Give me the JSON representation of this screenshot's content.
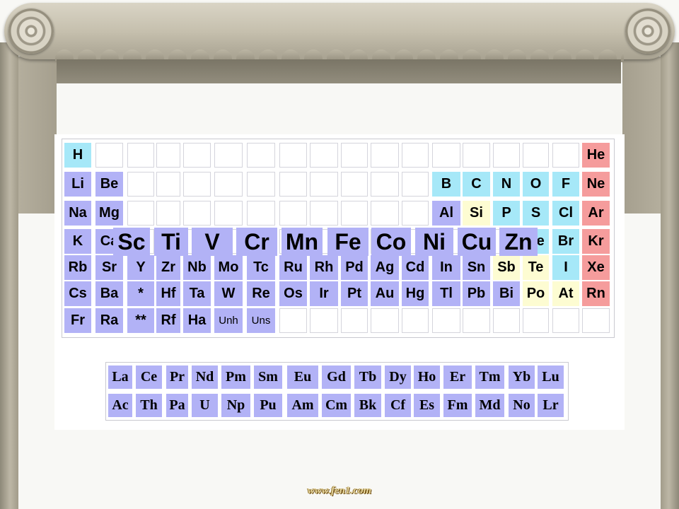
{
  "colors": {
    "cyan": "#a6e8f8",
    "lavender": "#b2b2f6",
    "yellow": "#fdfcd2",
    "pink": "#f59c9c",
    "stone": "#c6c0ae"
  },
  "periodic_table": {
    "rows": [
      [
        {
          "s": "H",
          "c": "cyan"
        },
        {
          "s": "",
          "c": "blank"
        },
        {
          "s": "",
          "c": "blank"
        },
        {
          "s": "",
          "c": "blank"
        },
        {
          "s": "",
          "c": "blank"
        },
        {
          "s": "",
          "c": "blank"
        },
        {
          "s": "",
          "c": "blank"
        },
        {
          "s": "",
          "c": "blank"
        },
        {
          "s": "",
          "c": "blank"
        },
        {
          "s": "",
          "c": "blank"
        },
        {
          "s": "",
          "c": "blank"
        },
        {
          "s": "",
          "c": "blank"
        },
        {
          "s": "",
          "c": "blank"
        },
        {
          "s": "",
          "c": "blank"
        },
        {
          "s": "",
          "c": "blank"
        },
        {
          "s": "",
          "c": "blank"
        },
        {
          "s": "",
          "c": "blank"
        },
        {
          "s": "He",
          "c": "pink"
        }
      ],
      [
        {
          "s": "Li",
          "c": "lavender"
        },
        {
          "s": "Be",
          "c": "lavender"
        },
        {
          "s": "",
          "c": "blank"
        },
        {
          "s": "",
          "c": "blank"
        },
        {
          "s": "",
          "c": "blank"
        },
        {
          "s": "",
          "c": "blank"
        },
        {
          "s": "",
          "c": "blank"
        },
        {
          "s": "",
          "c": "blank"
        },
        {
          "s": "",
          "c": "blank"
        },
        {
          "s": "",
          "c": "blank"
        },
        {
          "s": "",
          "c": "blank"
        },
        {
          "s": "",
          "c": "blank"
        },
        {
          "s": "B",
          "c": "cyan"
        },
        {
          "s": "C",
          "c": "cyan"
        },
        {
          "s": "N",
          "c": "cyan"
        },
        {
          "s": "O",
          "c": "cyan"
        },
        {
          "s": "F",
          "c": "cyan"
        },
        {
          "s": "Ne",
          "c": "pink"
        }
      ],
      [
        {
          "s": "Na",
          "c": "lavender"
        },
        {
          "s": "Mg",
          "c": "lavender"
        },
        {
          "s": "",
          "c": "blank"
        },
        {
          "s": "",
          "c": "blank"
        },
        {
          "s": "",
          "c": "blank"
        },
        {
          "s": "",
          "c": "blank"
        },
        {
          "s": "",
          "c": "blank"
        },
        {
          "s": "",
          "c": "blank"
        },
        {
          "s": "",
          "c": "blank"
        },
        {
          "s": "",
          "c": "blank"
        },
        {
          "s": "",
          "c": "blank"
        },
        {
          "s": "",
          "c": "blank"
        },
        {
          "s": "Al",
          "c": "lavender"
        },
        {
          "s": "Si",
          "c": "yellow"
        },
        {
          "s": "P",
          "c": "cyan"
        },
        {
          "s": "S",
          "c": "cyan"
        },
        {
          "s": "Cl",
          "c": "cyan"
        },
        {
          "s": "Ar",
          "c": "pink"
        }
      ],
      [
        {
          "s": "K",
          "c": "lavender"
        },
        {
          "s": "Ca",
          "c": "lavender"
        },
        {
          "s": "",
          "c": "blank"
        },
        {
          "s": "",
          "c": "blank"
        },
        {
          "s": "",
          "c": "blank"
        },
        {
          "s": "",
          "c": "blank"
        },
        {
          "s": "",
          "c": "blank"
        },
        {
          "s": "",
          "c": "blank"
        },
        {
          "s": "",
          "c": "blank"
        },
        {
          "s": "",
          "c": "blank"
        },
        {
          "s": "",
          "c": "blank"
        },
        {
          "s": "",
          "c": "blank"
        },
        {
          "s": "",
          "c": "blank"
        },
        {
          "s": "",
          "c": "blank"
        },
        {
          "s": "",
          "c": "blank"
        },
        {
          "s": "Se",
          "c": "cyan"
        },
        {
          "s": "Br",
          "c": "cyan"
        },
        {
          "s": "Kr",
          "c": "pink"
        }
      ],
      [
        {
          "s": "Rb",
          "c": "lavender"
        },
        {
          "s": "Sr",
          "c": "lavender"
        },
        {
          "s": "Y",
          "c": "lavender"
        },
        {
          "s": "Zr",
          "c": "lavender"
        },
        {
          "s": "Nb",
          "c": "lavender"
        },
        {
          "s": "Mo",
          "c": "lavender"
        },
        {
          "s": "Tc",
          "c": "lavender"
        },
        {
          "s": "Ru",
          "c": "lavender"
        },
        {
          "s": "Rh",
          "c": "lavender"
        },
        {
          "s": "Pd",
          "c": "lavender"
        },
        {
          "s": "Ag",
          "c": "lavender"
        },
        {
          "s": "Cd",
          "c": "lavender"
        },
        {
          "s": "In",
          "c": "lavender"
        },
        {
          "s": "Sn",
          "c": "lavender"
        },
        {
          "s": "Sb",
          "c": "yellow"
        },
        {
          "s": "Te",
          "c": "yellow"
        },
        {
          "s": "I",
          "c": "cyan"
        },
        {
          "s": "Xe",
          "c": "pink"
        }
      ],
      [
        {
          "s": "Cs",
          "c": "lavender"
        },
        {
          "s": "Ba",
          "c": "lavender"
        },
        {
          "s": "*",
          "c": "lavender"
        },
        {
          "s": "Hf",
          "c": "lavender"
        },
        {
          "s": "Ta",
          "c": "lavender"
        },
        {
          "s": "W",
          "c": "lavender"
        },
        {
          "s": "Re",
          "c": "lavender"
        },
        {
          "s": "Os",
          "c": "lavender"
        },
        {
          "s": "Ir",
          "c": "lavender"
        },
        {
          "s": "Pt",
          "c": "lavender"
        },
        {
          "s": "Au",
          "c": "lavender"
        },
        {
          "s": "Hg",
          "c": "lavender"
        },
        {
          "s": "Tl",
          "c": "lavender"
        },
        {
          "s": "Pb",
          "c": "lavender"
        },
        {
          "s": "Bi",
          "c": "lavender"
        },
        {
          "s": "Po",
          "c": "yellow"
        },
        {
          "s": "At",
          "c": "yellow"
        },
        {
          "s": "Rn",
          "c": "pink"
        }
      ],
      [
        {
          "s": "Fr",
          "c": "lavender"
        },
        {
          "s": "Ra",
          "c": "lavender"
        },
        {
          "s": "**",
          "c": "lavender"
        },
        {
          "s": "Rf",
          "c": "lavender"
        },
        {
          "s": "Ha",
          "c": "lavender"
        },
        {
          "s": "Unh",
          "c": "lavender"
        },
        {
          "s": "Uns",
          "c": "lavender"
        },
        {
          "s": "",
          "c": "blank"
        },
        {
          "s": "",
          "c": "blank"
        },
        {
          "s": "",
          "c": "blank"
        },
        {
          "s": "",
          "c": "blank"
        },
        {
          "s": "",
          "c": "blank"
        },
        {
          "s": "",
          "c": "blank"
        },
        {
          "s": "",
          "c": "blank"
        },
        {
          "s": "",
          "c": "blank"
        },
        {
          "s": "",
          "c": "blank"
        },
        {
          "s": "",
          "c": "blank"
        },
        {
          "s": "",
          "c": "blank"
        }
      ]
    ],
    "transition_highlight": [
      "Sc",
      "Ti",
      "V",
      "Cr",
      "Mn",
      "Fe",
      "Co",
      "Ni",
      "Cu",
      "Zn"
    ],
    "lanthanides": [
      "La",
      "Ce",
      "Pr",
      "Nd",
      "Pm",
      "Sm",
      "Eu",
      "Gd",
      "Tb",
      "Dy",
      "Ho",
      "Er",
      "Tm",
      "Yb",
      "Lu"
    ],
    "actinides": [
      "Ac",
      "Th",
      "Pa",
      "U",
      "Np",
      "Pu",
      "Am",
      "Cm",
      "Bk",
      "Cf",
      "Es",
      "Fm",
      "Md",
      "No",
      "Lr"
    ]
  },
  "footer": {
    "watermark": "www.fen1.com"
  }
}
